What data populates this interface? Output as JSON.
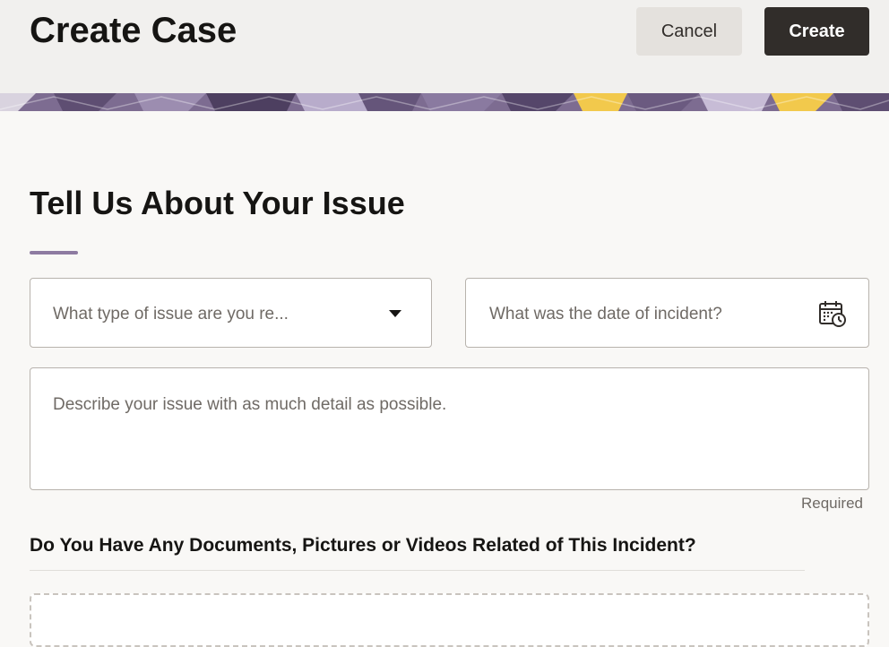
{
  "header": {
    "title": "Create Case",
    "cancel_label": "Cancel",
    "create_label": "Create"
  },
  "colors": {
    "primary_button": "#312d2a",
    "secondary_button": "#e4e1dd",
    "accent_underline": "#8e7ba1",
    "banner_purple": "#6b5a80",
    "banner_yellow": "#f2c94c"
  },
  "form": {
    "section_title": "Tell Us About Your Issue",
    "issue_type_placeholder": "What type of issue are you re...",
    "incident_date_placeholder": "What was the date of incident?",
    "description_placeholder": "Describe your issue with as much detail as possible.",
    "required_note": "Required",
    "documents_title": "Do You Have Any Documents, Pictures or Videos Related of This Incident?"
  },
  "icons": {
    "select_caret": "chevron-down-icon",
    "date_picker": "calendar-icon"
  }
}
